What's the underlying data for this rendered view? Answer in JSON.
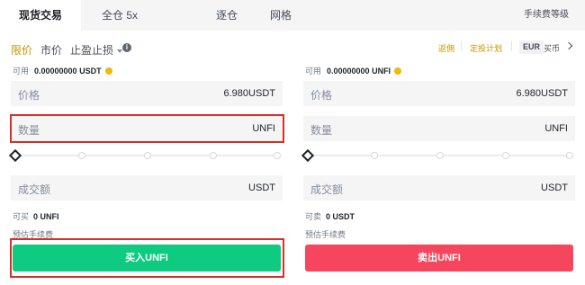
{
  "tabs": [
    {
      "label": "现货交易",
      "active": true
    },
    {
      "label": "全仓 5x",
      "active": false
    },
    {
      "label": "逐仓",
      "active": false
    },
    {
      "label": "网格",
      "active": false
    }
  ],
  "fee_link": "手续费等级",
  "order_types": {
    "limit": "限价",
    "market": "市价",
    "stop_limit": "止盈止损"
  },
  "right_links": {
    "rebate": "返佣",
    "buy_plan": "定投计划",
    "currency": "EUR",
    "buy": "买币"
  },
  "colors": {
    "accent": "#c99400",
    "buy": "#0ecb81",
    "sell": "#f6465d",
    "highlight": "#d93025"
  },
  "buy_panel": {
    "available_label": "可用",
    "available_value": "0.00000000 USDT",
    "price_label": "价格",
    "price_value": "6.980",
    "price_unit": "USDT",
    "amount_label": "数量",
    "amount_unit": "UNFI",
    "total_label": "成交额",
    "total_unit": "USDT",
    "can_buy_label": "可买",
    "can_buy_value": "0 UNFI",
    "fee_label": "预估手续费",
    "button_label": "买入UNFI"
  },
  "sell_panel": {
    "available_label": "可用",
    "available_value": "0.00000000 UNFI",
    "price_label": "价格",
    "price_value": "6.980",
    "price_unit": "USDT",
    "amount_label": "数量",
    "amount_unit": "UNFI",
    "total_label": "成交额",
    "total_unit": "USDT",
    "can_sell_label": "可卖",
    "can_sell_value": "0 USDT",
    "fee_label": "预估手续费",
    "button_label": "卖出UNFI"
  }
}
